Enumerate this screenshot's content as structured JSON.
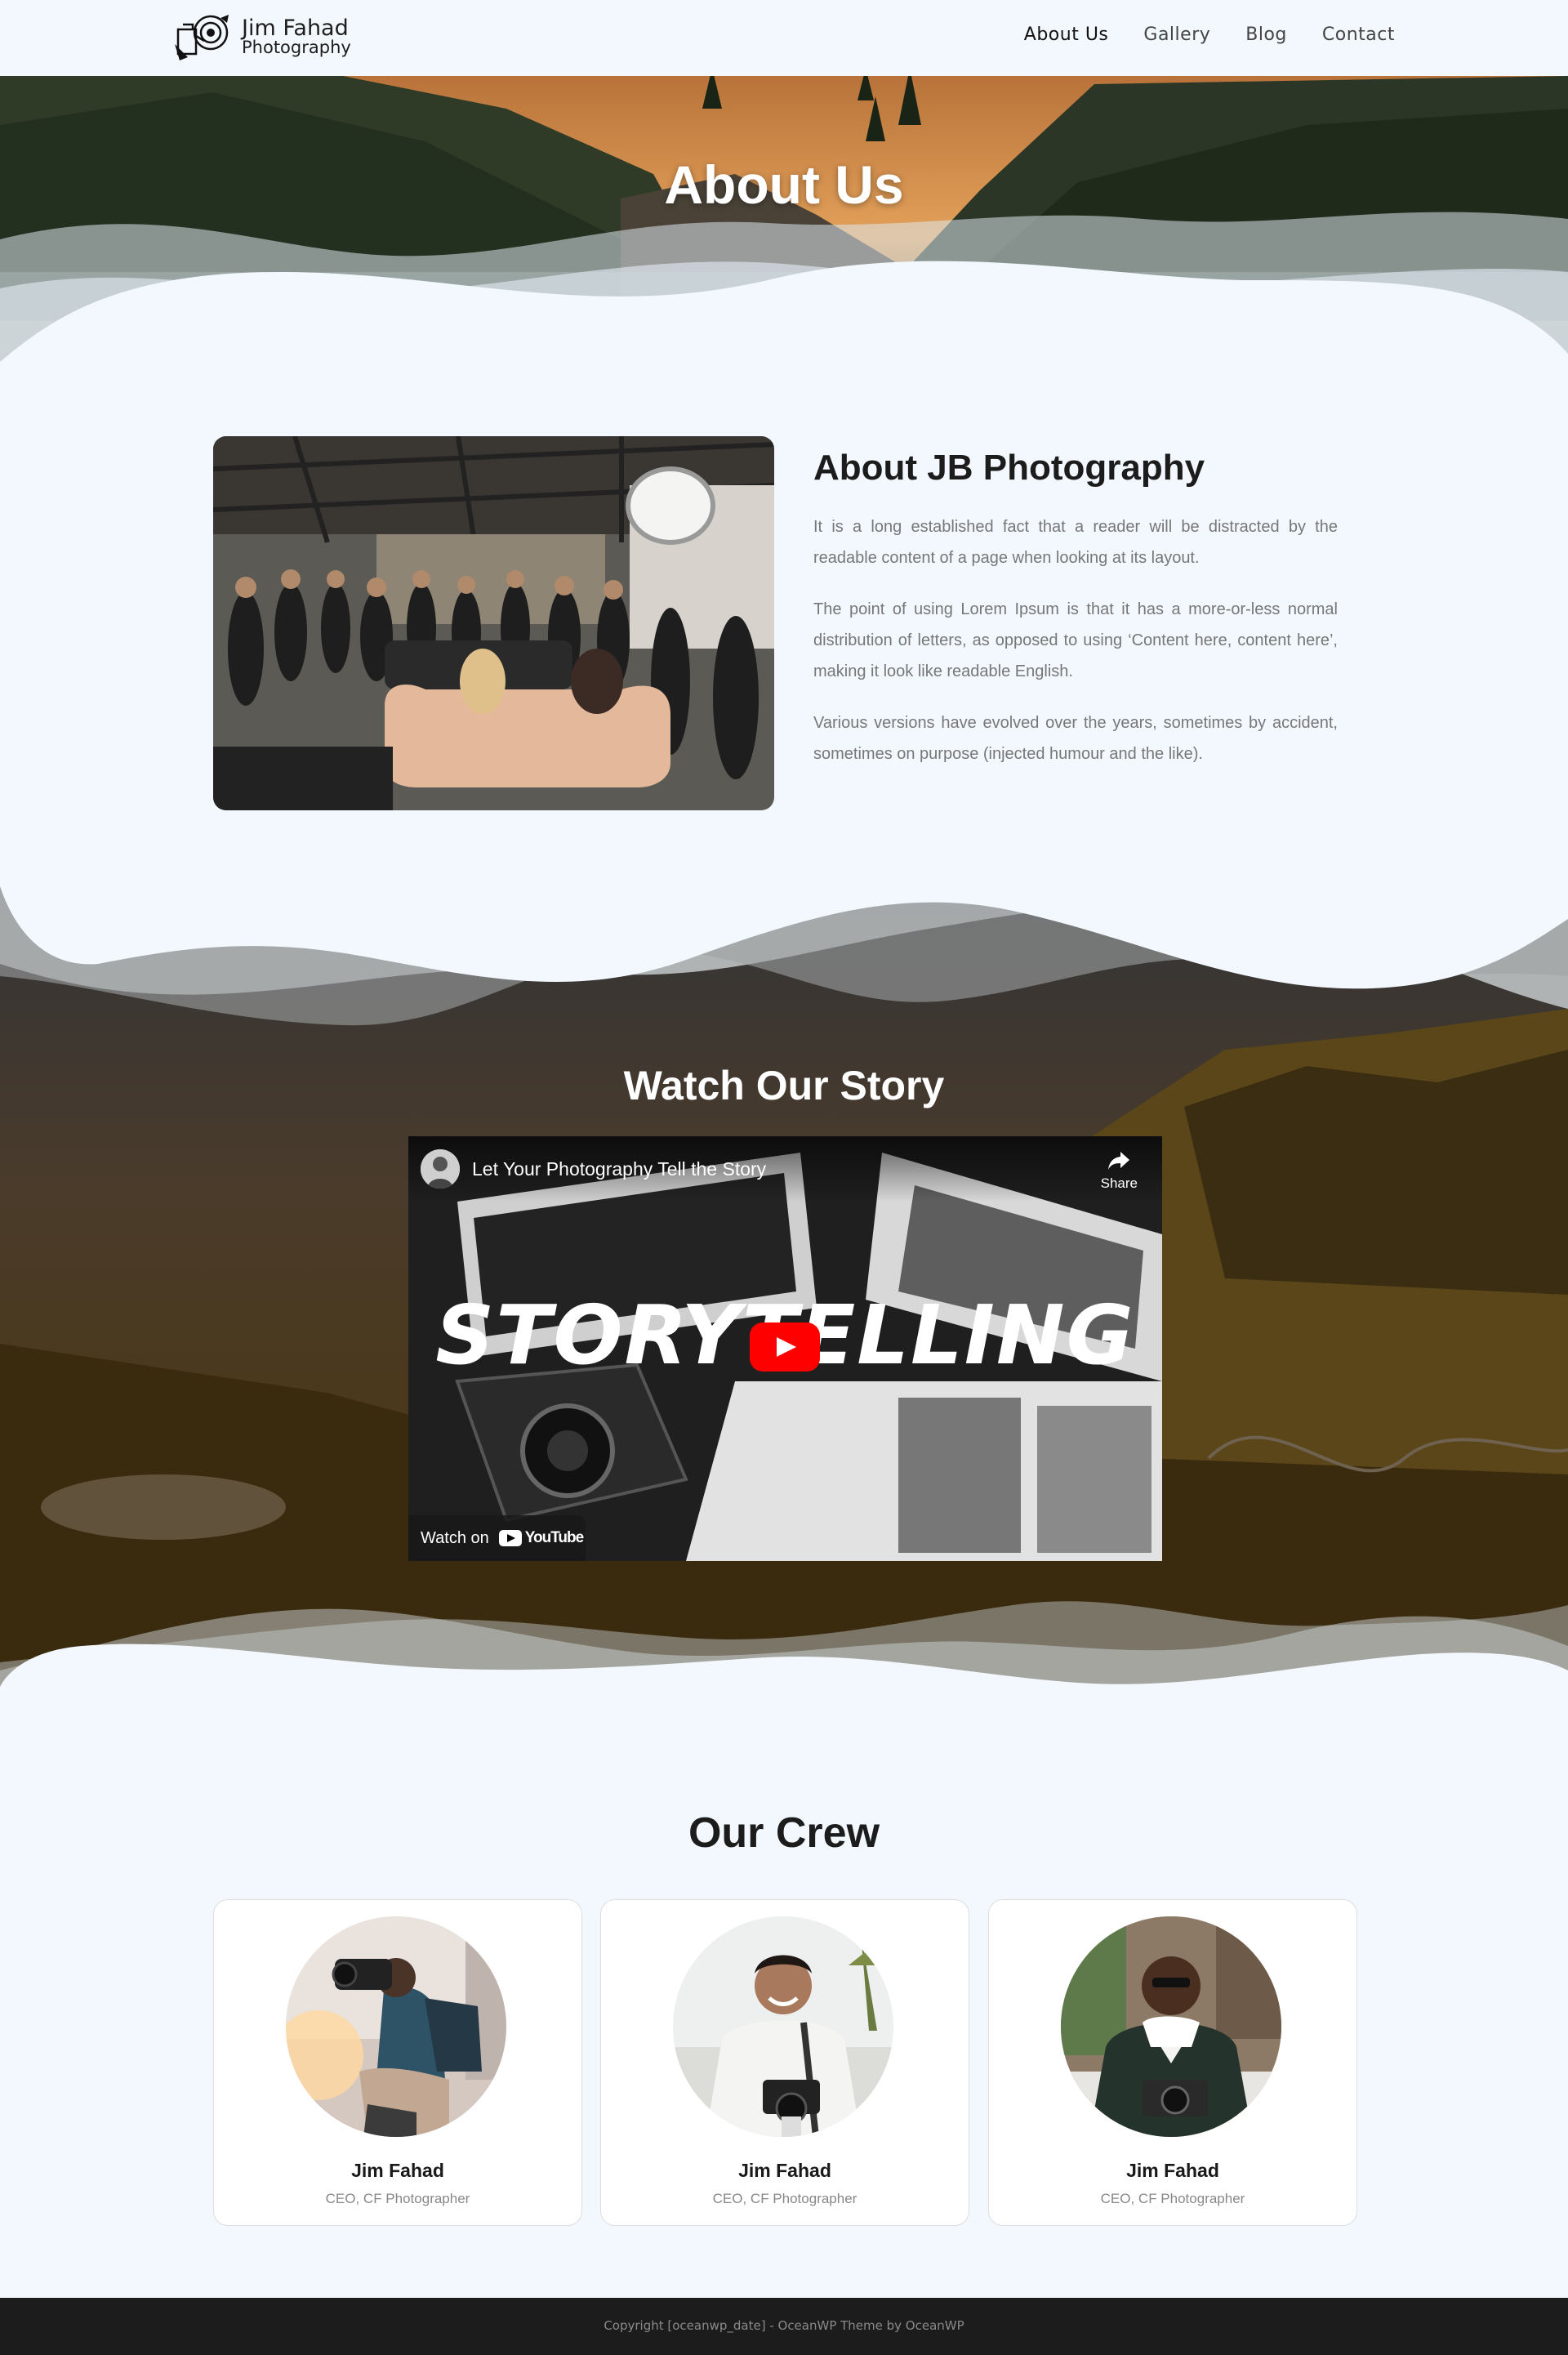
{
  "header": {
    "logo_line1": "Jim Fahad",
    "logo_line2": "Photography",
    "nav": [
      {
        "label": "About Us",
        "active": true
      },
      {
        "label": "Gallery"
      },
      {
        "label": "Blog"
      },
      {
        "label": "Contact"
      }
    ]
  },
  "hero": {
    "title": "About Us"
  },
  "about": {
    "heading": "About JB Photography",
    "paragraphs": [
      "It is a long established fact that a reader will be distracted by the readable content of a page when looking at its layout.",
      "The point of using Lorem Ipsum is that it has a more-or-less normal distribution of letters, as opposed to using ‘Content here, content here’, making it look like readable English.",
      "Various versions have evolved over the years, sometimes by accident, sometimes on purpose (injected humour and the like)."
    ]
  },
  "story": {
    "title": "Watch Our Story",
    "video": {
      "title": "Let Your Photography Tell the Story",
      "share_label": "Share",
      "overlay_word": "STORYTELLING",
      "watch_on": "Watch on",
      "youtube_label": "YouTube"
    }
  },
  "crew": {
    "title": "Our Crew",
    "members": [
      {
        "name": "Jim Fahad",
        "role": "CEO, CF Photographer"
      },
      {
        "name": "Jim Fahad",
        "role": "CEO, CF Photographer"
      },
      {
        "name": "Jim Fahad",
        "role": "CEO, CF Photographer"
      }
    ]
  },
  "footer": {
    "copyright": "Copyright [oceanwp_date] - OceanWP Theme by OceanWP"
  },
  "colors": {
    "page_bg": "#f2f8fe",
    "footer_bg": "#1c1c1d",
    "play_red": "#ff0000"
  }
}
